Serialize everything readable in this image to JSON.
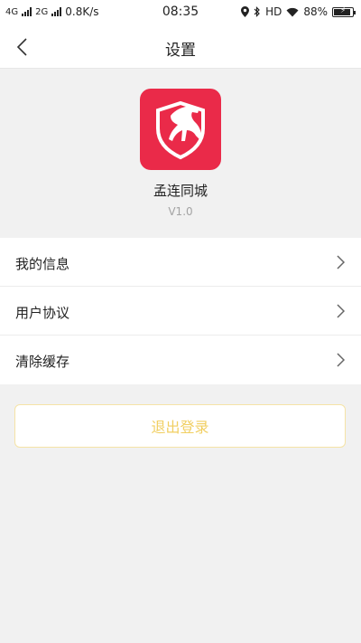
{
  "status_bar": {
    "net1": "4G",
    "net2": "2G",
    "speed": "0.8K/s",
    "time": "08:35",
    "hd": "HD",
    "battery": "88%",
    "battery_level": 0.88
  },
  "nav": {
    "title": "设置",
    "back_icon": "chevron-left-icon"
  },
  "app": {
    "name": "孟连同城",
    "version": "V1.0",
    "icon_color": "#ea2a49"
  },
  "menu": {
    "items": [
      {
        "label": "我的信息"
      },
      {
        "label": "用户协议"
      },
      {
        "label": "清除缓存"
      }
    ]
  },
  "logout": {
    "label": "退出登录",
    "text_color": "#f1cf62"
  }
}
